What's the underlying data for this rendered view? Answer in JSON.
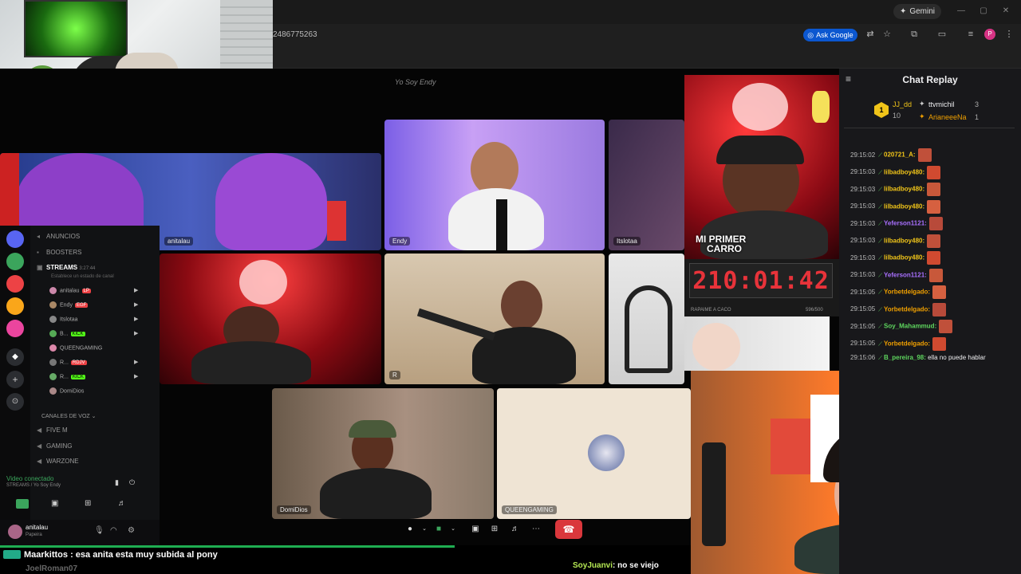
{
  "browser": {
    "gemini_label": "Gemini",
    "url_fragment": "2486775263",
    "ask_google_label": "Ask Google",
    "profile_initial": "P"
  },
  "stream": {
    "title": "Yo Soy Endy"
  },
  "tiles": [
    {
      "name": "anitalau"
    },
    {
      "name": "Endy"
    },
    {
      "name": "Itslotaa"
    },
    {
      "name": "R"
    },
    {
      "name": "QUEENGAMING"
    },
    {
      "name": "DomiDios"
    }
  ],
  "discord": {
    "channels": [
      {
        "label": "ANUNCIOS"
      },
      {
        "label": "BOOSTERS"
      },
      {
        "label": "STREAMS",
        "time": "3:27:44"
      },
      {
        "label": "Establece un estado de canal"
      }
    ],
    "stream_members": [
      {
        "name": "anitalau",
        "badge": "LP"
      },
      {
        "name": "Endy",
        "badge": "EGF"
      },
      {
        "name": "Itslotaa",
        "badge": ""
      },
      {
        "name": "B...",
        "badge": "KICK"
      },
      {
        "name": "QUEENGAMING",
        "badge": ""
      },
      {
        "name": "R...",
        "badge": "RDJV"
      },
      {
        "name": "R...",
        "badge": "KICK"
      },
      {
        "name": "DomiDios",
        "badge": ""
      }
    ],
    "voice_category": "CANALES DE VOZ",
    "voice_channels": [
      "FIVE M",
      "GAMING",
      "WARZONE"
    ],
    "voice_status": "Video conectado",
    "voice_sub": "STREAMS / Yo Soy Endy",
    "user_name": "anitalau",
    "user_status": "Papeira"
  },
  "overlay": {
    "message": "Maarkittos : esa anita esta muy subida al pony",
    "next_user": "JoelRoman07",
    "juanvi_user": "SoyJuanvi",
    "juanvi_text": ": no se viejo"
  },
  "chat_replay": {
    "title": "Chat Replay",
    "leaderboard": [
      {
        "name": "JJ_dd",
        "count": "10"
      },
      {
        "name": "ttvmichil",
        "count": "3"
      },
      {
        "name": "ArianeeeNa",
        "count": "1"
      }
    ],
    "messages": [
      {
        "time": "29:15:02",
        "user": "020721_A:",
        "color": "#f0c419",
        "text": ""
      },
      {
        "time": "29:15:03",
        "user": "lilbadboy480:",
        "color": "#f0c419",
        "text": ""
      },
      {
        "time": "29:15:03",
        "user": "lilbadboy480:",
        "color": "#f0c419",
        "text": ""
      },
      {
        "time": "29:15:03",
        "user": "lilbadboy480:",
        "color": "#f0c419",
        "text": ""
      },
      {
        "time": "29:15:03",
        "user": "Yeferson1121:",
        "color": "#a970ff",
        "text": ""
      },
      {
        "time": "29:15:03",
        "user": "lilbadboy480:",
        "color": "#f0c419",
        "text": ""
      },
      {
        "time": "29:15:03",
        "user": "lilbadboy480:",
        "color": "#f0c419",
        "text": ""
      },
      {
        "time": "29:15:03",
        "user": "Yeferson1121:",
        "color": "#a970ff",
        "text": ""
      },
      {
        "time": "29:15:05",
        "user": "Yorbetdelgado:",
        "color": "#f0a000",
        "text": ""
      },
      {
        "time": "29:15:05",
        "user": "Yorbetdelgado:",
        "color": "#f0a000",
        "text": ""
      },
      {
        "time": "29:15:05",
        "user": "Soy_Mahammud:",
        "color": "#5ed65e",
        "text": ""
      },
      {
        "time": "29:15:05",
        "user": "Yorbetdelgado:",
        "color": "#f0a000",
        "text": ""
      },
      {
        "time": "29:15:06",
        "user": "B_pereira_98:",
        "color": "#5ed65e",
        "text": "ella no puede hablar"
      }
    ]
  },
  "timer": {
    "value": "210:01:42",
    "caption": "RAPAIME A CACO",
    "count": "596/500",
    "banner_line1": "MI PRIMER",
    "banner_line2": "CARRO"
  },
  "colors": {
    "accent_red": "#da373c",
    "twitch_purple": "#a970ff",
    "chat_bg": "#18181b",
    "discord_bg": "#111214"
  }
}
